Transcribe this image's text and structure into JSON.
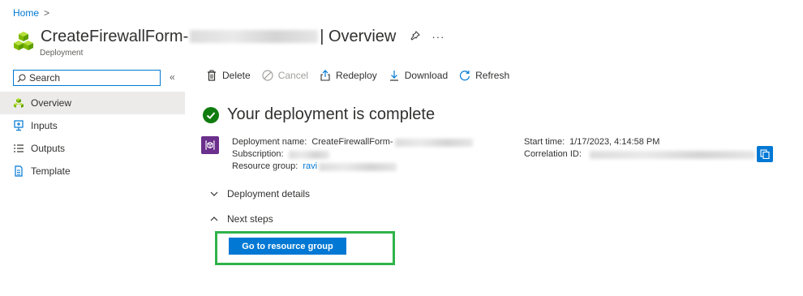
{
  "breadcrumb": {
    "home": "Home",
    "separator": ">"
  },
  "header": {
    "title_prefix": "CreateFirewallForm-",
    "title_suffix": "| Overview",
    "subtitle": "Deployment",
    "pin_icon": "pin-icon",
    "more_icon": "···"
  },
  "sidebar": {
    "search_placeholder": "Search",
    "collapse": "«",
    "items": [
      {
        "label": "Overview",
        "icon": "overview-icon",
        "active": true
      },
      {
        "label": "Inputs",
        "icon": "inputs-icon",
        "active": false
      },
      {
        "label": "Outputs",
        "icon": "outputs-icon",
        "active": false
      },
      {
        "label": "Template",
        "icon": "template-icon",
        "active": false
      }
    ]
  },
  "toolbar": {
    "delete": "Delete",
    "cancel": "Cancel",
    "redeploy": "Redeploy",
    "download": "Download",
    "refresh": "Refresh"
  },
  "status": {
    "text": "Your deployment is complete",
    "color": "#107c10"
  },
  "details": {
    "deployment_name_label": "Deployment name:",
    "deployment_name_value": "CreateFirewallForm-",
    "subscription_label": "Subscription:",
    "resource_group_label": "Resource group:",
    "resource_group_value": "ravi",
    "start_time_label": "Start time:",
    "start_time_value": "1/17/2023, 4:14:58 PM",
    "correlation_label": "Correlation ID:"
  },
  "sections": {
    "deployment_details": "Deployment details",
    "next_steps": "Next steps"
  },
  "actions": {
    "go_to_resource_group": "Go to resource group"
  },
  "colors": {
    "accent": "#0078d4",
    "highlight_border": "#2fb34a",
    "deployment_icon_bg": "#6b2f8c"
  }
}
